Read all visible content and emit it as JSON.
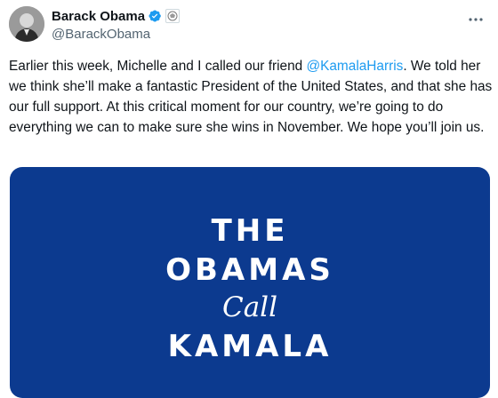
{
  "author": {
    "display_name": "Barack Obama",
    "handle": "@BarackObama",
    "verified_icon": "verified-badge-icon",
    "affiliation_icon": "seal-icon"
  },
  "tweet": {
    "text_1": "Earlier this week, Michelle and I called our friend ",
    "mention": "@KamalaHarris",
    "text_2": ". We told her we think she’ll make a fantastic President of the United States, and that she has our full support. At this critical moment for our country, we’re going to do everything we can to make sure she wins in November. We hope you’ll join us."
  },
  "media": {
    "line_1": "THE",
    "line_2": "OBAMAS",
    "line_3": "Call",
    "line_4": "KAMALA",
    "background": "#0c3a8f"
  },
  "colors": {
    "link": "#1d9bf0",
    "verified": "#1d9bf0",
    "text": "#0f1419",
    "secondary": "#536471"
  },
  "actions": {
    "more_icon": "more-horizontal-icon"
  }
}
